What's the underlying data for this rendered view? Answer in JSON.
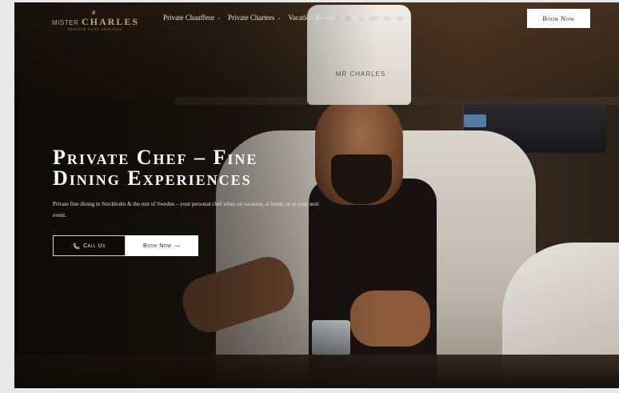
{
  "nav": {
    "logo_mister": "MISTER",
    "logo_charles": "CHARLES",
    "logo_tagline": "PRIVATE LUXE SERVICES",
    "menu": [
      {
        "label": "Private Chauffeur",
        "has_dropdown": true
      },
      {
        "label": "Private Charters",
        "has_dropdown": true
      },
      {
        "label": "Vacation Rentals",
        "has_dropdown": true
      },
      {
        "label": "More",
        "has_dropdown": true
      }
    ],
    "book_label": "Book Now"
  },
  "hero": {
    "title_line1": "Private Chef – Fine",
    "title_line2": "Dining Experiences",
    "subtitle": "Private fine dining in Stockholm & the rest of Sweden – your personal chef when on vacation, at home, or at your next event.",
    "call_label": "Call Us",
    "book_label": "Book Now",
    "book_arrow": "—"
  },
  "scene": {
    "hat_text": "MR CHARLES"
  },
  "colors": {
    "gold": "#c6a572",
    "dark_bg": "#16110c",
    "button_bg": "#ffffff"
  },
  "icons": {
    "phone": "phone-icon",
    "chevron": "chevron-down-icon",
    "arrow": "arrow-right-icon"
  }
}
